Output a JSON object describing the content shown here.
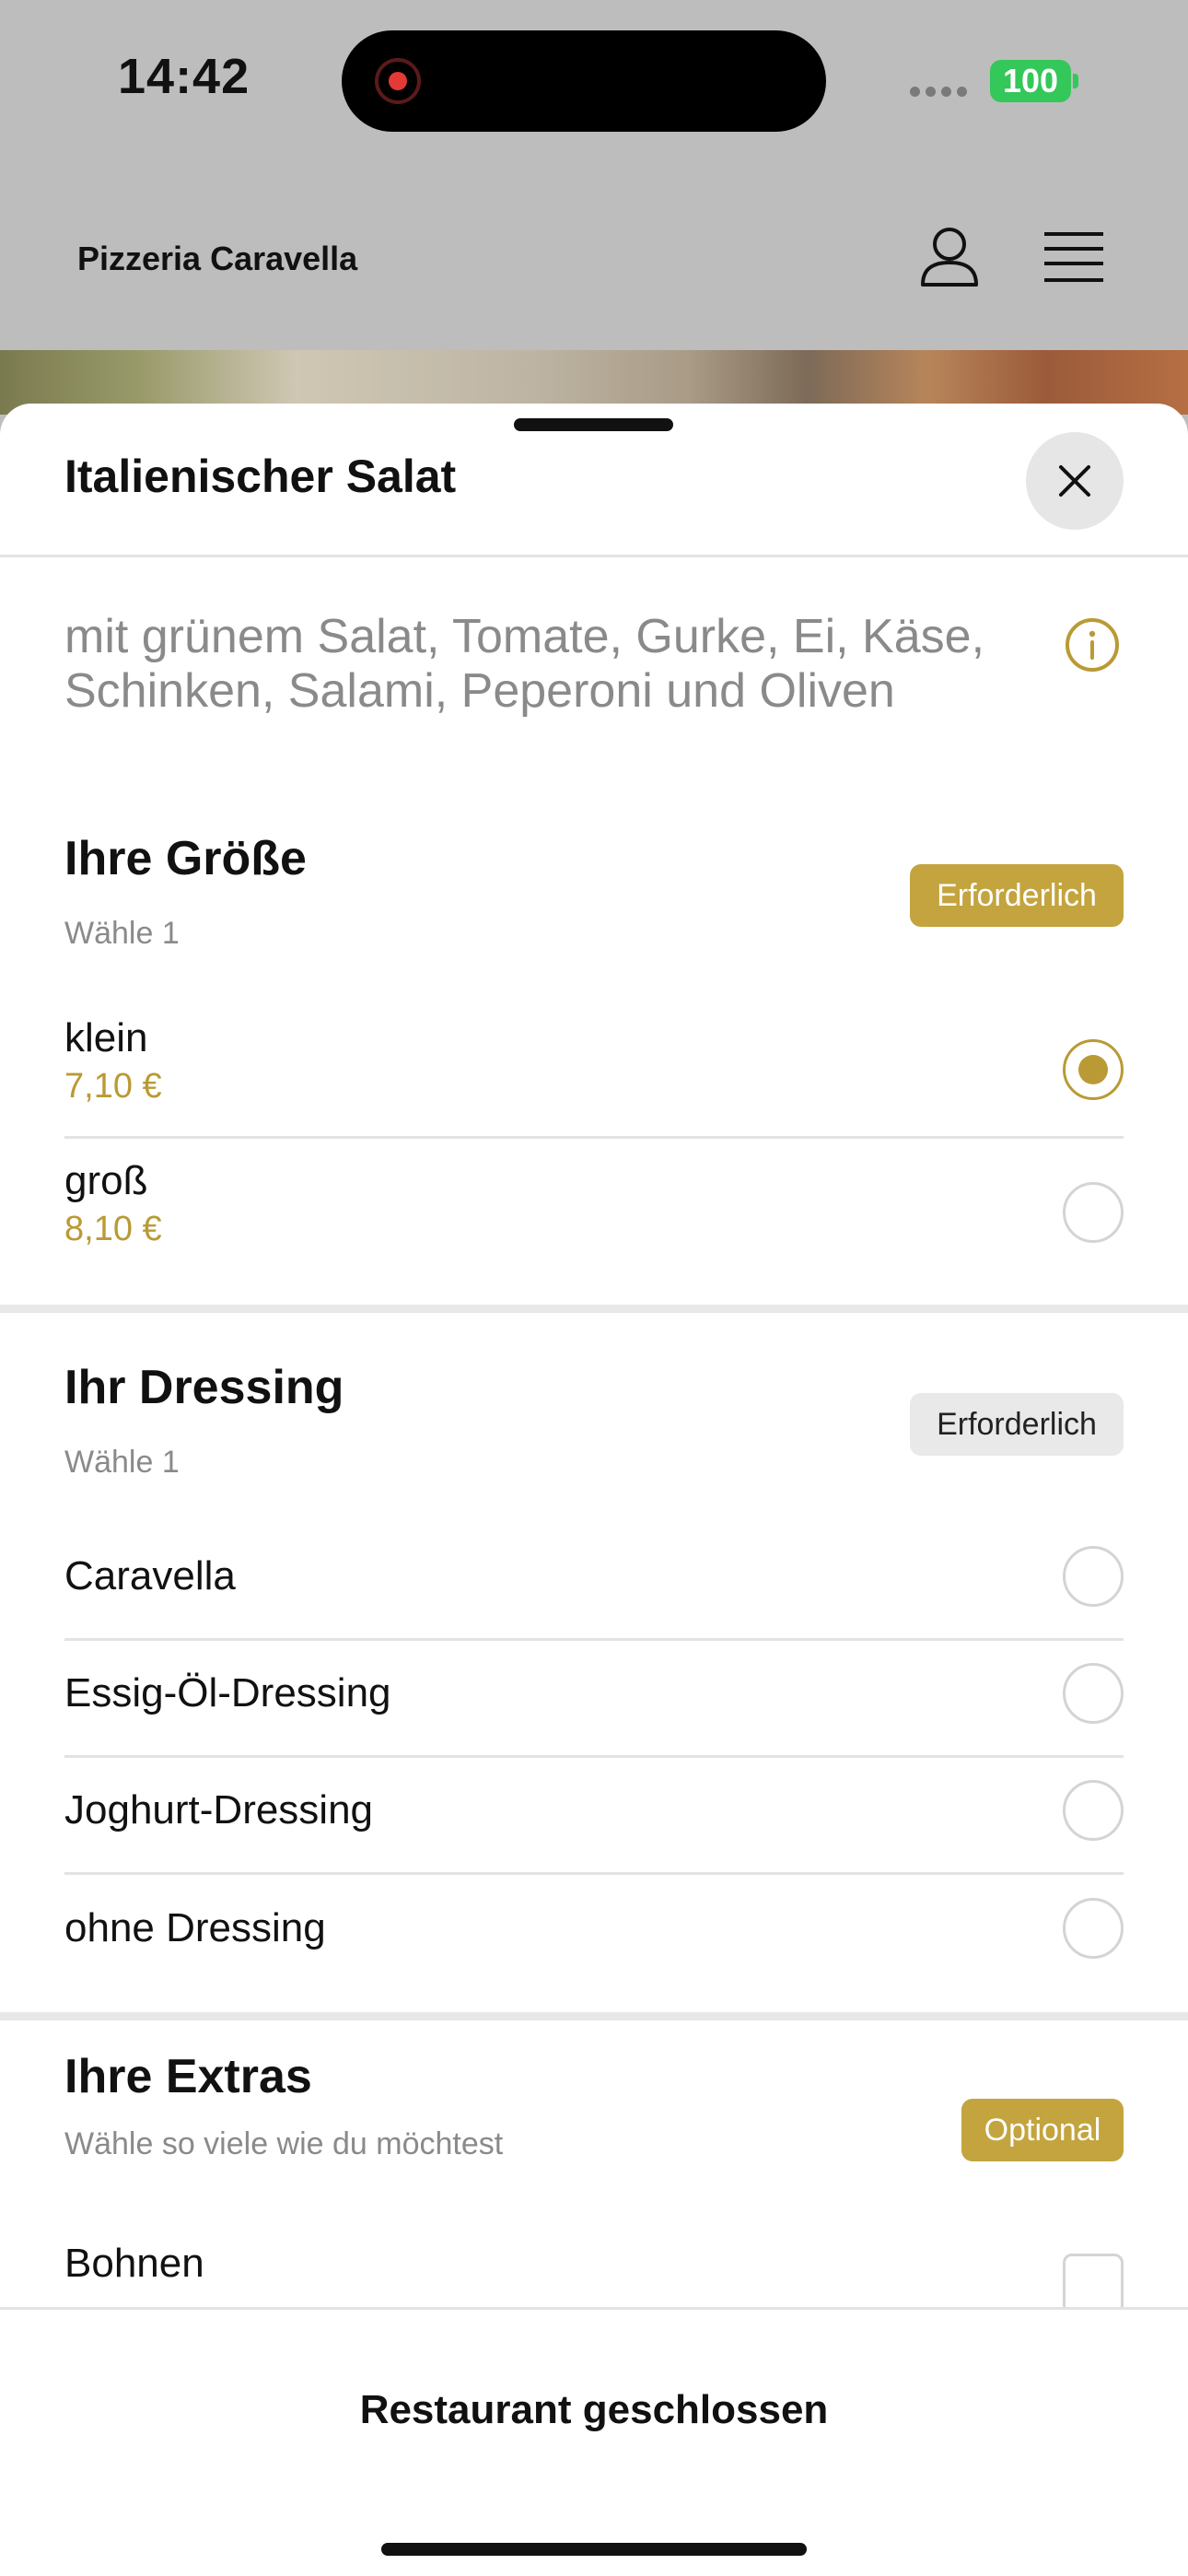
{
  "status_bar": {
    "time": "14:42",
    "battery": "100"
  },
  "app_header": {
    "title": "Pizzeria Caravella"
  },
  "sheet": {
    "title": "Italienischer Salat",
    "description": "mit grünem Salat, Tomate, Gurke, Ei, Käse, Schinken, Salami, Peperoni und Oliven"
  },
  "sections": {
    "size": {
      "title": "Ihre Größe",
      "subtitle": "Wähle 1",
      "badge": "Erforderlich",
      "options": [
        {
          "label": "klein",
          "price": "7,10 €",
          "selected": true
        },
        {
          "label": "groß",
          "price": "8,10 €",
          "selected": false
        }
      ]
    },
    "dressing": {
      "title": "Ihr Dressing",
      "subtitle": "Wähle 1",
      "badge": "Erforderlich",
      "options": [
        {
          "label": "Caravella"
        },
        {
          "label": "Essig-Öl-Dressing"
        },
        {
          "label": "Joghurt-Dressing"
        },
        {
          "label": "ohne Dressing"
        }
      ]
    },
    "extras": {
      "title": "Ihre Extras",
      "subtitle": "Wähle so viele wie du möchtest",
      "badge": "Optional",
      "options": [
        {
          "label": "Bohnen"
        }
      ]
    }
  },
  "footer": {
    "label": "Restaurant geschlossen"
  },
  "colors": {
    "accent": "#c3a43e",
    "battery": "#34c759"
  }
}
